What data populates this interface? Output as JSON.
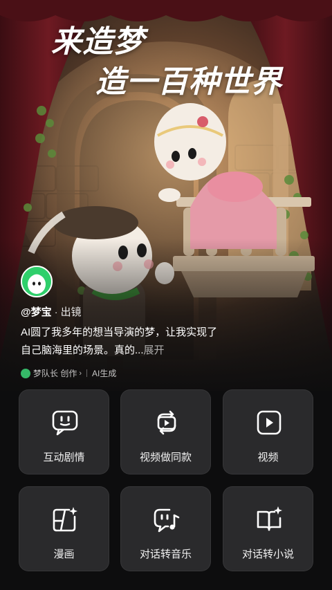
{
  "hero": {
    "headline_line1": "来造梦",
    "headline_line2": "造一百种世界"
  },
  "author": {
    "handle": "@梦宝",
    "separator": "·",
    "role": "出镜"
  },
  "description": {
    "text": "AI圆了我多年的想当导演的梦，让我实现了自己脑海里的场景。真的...",
    "expand_label": "展开"
  },
  "meta": {
    "creator_label": "梦队长 创作",
    "chevron": "›",
    "ai_label": "AI生成"
  },
  "actions": [
    {
      "label": "互动剧情",
      "icon": "chat-smile-icon"
    },
    {
      "label": "视频做同款",
      "icon": "video-remix-icon"
    },
    {
      "label": "视频",
      "icon": "play-icon"
    },
    {
      "label": "漫画",
      "icon": "comic-sparkle-icon"
    },
    {
      "label": "对话转音乐",
      "icon": "chat-music-icon"
    },
    {
      "label": "对话转小说",
      "icon": "book-sparkle-icon"
    }
  ],
  "colors": {
    "background": "#0d0d0e",
    "card": "#2a2a2c",
    "avatar_green": "#2fcf6b"
  }
}
